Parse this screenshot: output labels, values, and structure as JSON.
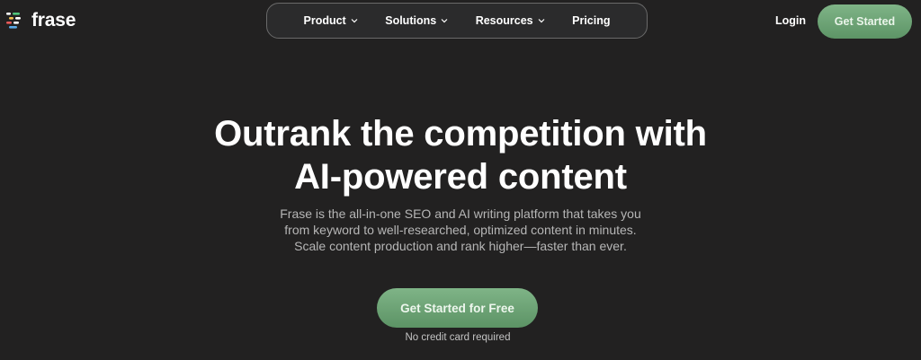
{
  "brand": {
    "name": "frase",
    "accent": "#6ea777",
    "background": "#222121"
  },
  "nav": {
    "items": [
      {
        "label": "Product",
        "has_dropdown": true
      },
      {
        "label": "Solutions",
        "has_dropdown": true
      },
      {
        "label": "Resources",
        "has_dropdown": true
      },
      {
        "label": "Pricing",
        "has_dropdown": false
      }
    ],
    "login_label": "Login",
    "cta_label": "Get Started"
  },
  "hero": {
    "title_lines": [
      "Outrank the competition with",
      "AI-powered content"
    ],
    "subtitle_lines": [
      "Frase is the all-in-one SEO and AI writing platform that takes you",
      "from keyword to well-researched, optimized content in minutes.",
      "Scale content production and rank higher—faster than ever."
    ],
    "cta_label": "Get Started for Free",
    "note": "No credit card required"
  },
  "icons": {
    "logo": "frase-logo-icon",
    "dropdown": "chevron-down-icon"
  }
}
